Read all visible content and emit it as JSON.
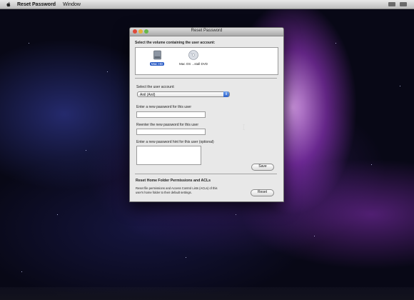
{
  "menubar": {
    "app_name": "Reset Password",
    "menu_window": "Window"
  },
  "window": {
    "title": "Reset Password",
    "volume_section_label": "Select the volume containing the user account:",
    "volumes": [
      {
        "name": "Mac HD",
        "icon": "hard-disk-icon",
        "selected": true
      },
      {
        "name": "Mac OS ...stall DVD",
        "icon": "dvd-icon",
        "selected": false
      }
    ],
    "user_label": "Select the user account:",
    "user_selected": "Anil (Anil)",
    "new_password_label": "Enter a new password for this user",
    "reenter_label": "Reenter the new password for this user",
    "hint_label": "Enter a new password hint for this user (optional)",
    "save_button": "Save",
    "reset_section_title": "Reset Home Folder Permissions and ACLs",
    "reset_desc_line1": "Reset file permissions and Access Control Lists (ACLs) of this",
    "reset_desc_line2": "user's home folder to their default settings.",
    "reset_button": "Reset"
  },
  "colors": {
    "selection": "#2e5fc7",
    "close": "#e04a3a",
    "minimize": "#e7b13a",
    "zoom": "#68b84a"
  }
}
